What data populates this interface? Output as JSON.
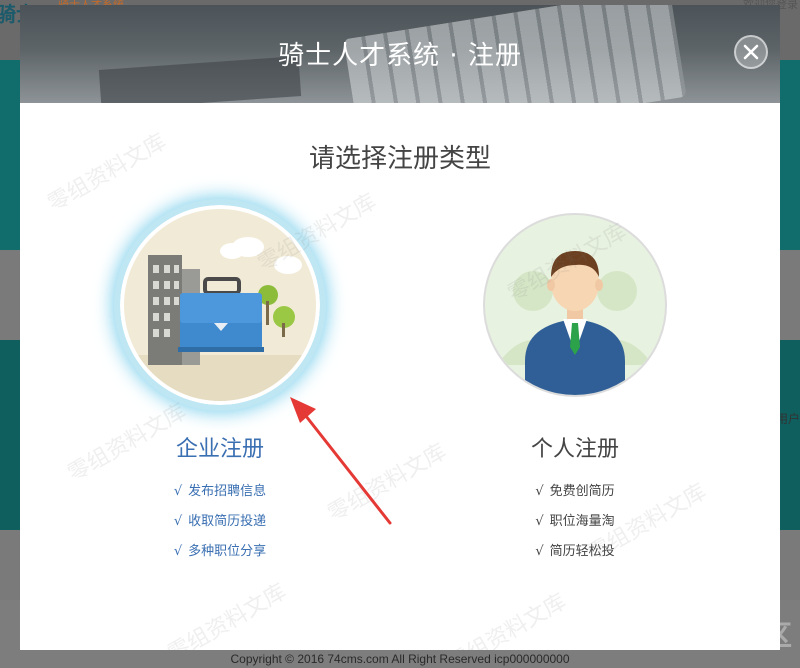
{
  "background": {
    "logo_text": "骑士",
    "logo_sub": "骑士人才系统",
    "top_right_fragment": "欢迎您登录",
    "right_fragment": "用户",
    "footer": "Copyright © 2016 74cms.com All Right Reserved icp000000000"
  },
  "modal": {
    "title": "骑士人才系统 · 注册",
    "close_icon": "close-icon",
    "subtitle": "请选择注册类型",
    "options": [
      {
        "title": "企业注册",
        "icon": "office-briefcase-icon",
        "features": [
          "发布招聘信息",
          "收取简历投递",
          "多种职位分享"
        ]
      },
      {
        "title": "个人注册",
        "icon": "person-avatar-icon",
        "features": [
          "免费创简历",
          "职位海量淘",
          "简历轻松投"
        ]
      }
    ],
    "tick": "√"
  },
  "annotation": {
    "arrow_color": "#e53935"
  },
  "watermark": {
    "text": "零组资料文库",
    "corner_logo": "先知社区"
  },
  "colors": {
    "enterprise_blue": "#3a6fb2",
    "ring_blue": "#7fd0ec",
    "text_dark": "#444444"
  }
}
